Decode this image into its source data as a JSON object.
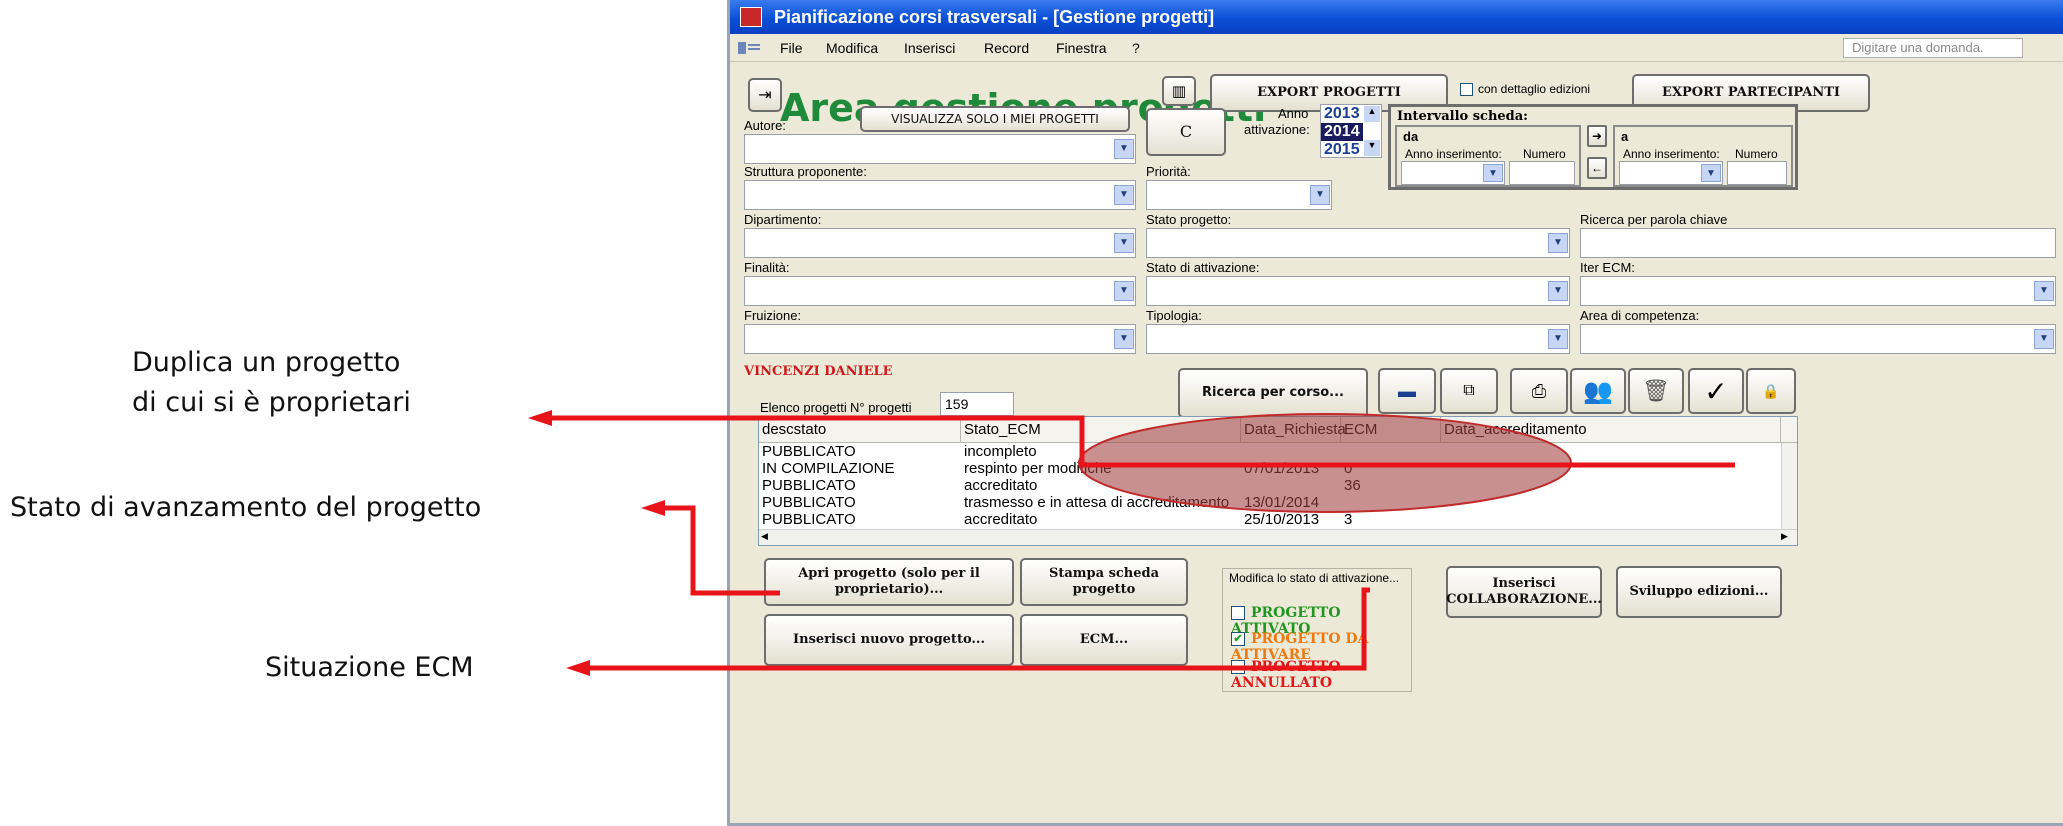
{
  "callouts": {
    "duplicate_line1": "Duplica un progetto",
    "duplicate_line2": "di cui si è proprietari",
    "status": "Stato di avanzamento del progetto",
    "ecm": "Situazione ECM"
  },
  "window": {
    "title": "Pianificazione corsi trasversali - [Gestione progetti]"
  },
  "menu": {
    "items": [
      "File",
      "Modifica",
      "Inserisci",
      "Record",
      "Finestra",
      "?"
    ],
    "help_placeholder": "Digitare una domanda."
  },
  "header": {
    "title": "Area gestione progetti",
    "export_projects": "EXPORT PROGETTI",
    "detail_checkbox": "con dettaglio edizioni",
    "export_participants": "EXPORT PARTECIPANTI"
  },
  "filters": {
    "author_label": "Autore:",
    "my_projects_button": "VISUALIZZA SOLO I MIEI PROGETTI",
    "refresh_icon": "C",
    "year_label_1": "Anno",
    "year_label_2": "attivazione:",
    "years": [
      "2013",
      "2014",
      "2015"
    ],
    "selected_year": "2014",
    "interval_title": "Intervallo scheda:",
    "from_label": "da",
    "to_label": "a",
    "insert_year_label": "Anno inserimento:",
    "number_label": "Numero",
    "structure_label": "Struttura proponente:",
    "priority_label": "Priorità:",
    "department_label": "Dipartimento:",
    "project_state_label": "Stato progetto:",
    "keyword_label": "Ricerca per parola chiave",
    "purpose_label": "Finalità:",
    "activation_state_label": "Stato di attivazione:",
    "ecm_iter_label": "Iter ECM:",
    "fruition_label": "Fruizione:",
    "type_label": "Tipologia:",
    "competence_label": "Area di competenza:"
  },
  "user": {
    "name": "VINCENZI DANIELE"
  },
  "list": {
    "title": "Elenco progetti",
    "count_label": "N° progetti",
    "count": "159",
    "search_button": "Ricerca per corso...",
    "columns": [
      "descstato",
      "Stato_ECM",
      "Data_Richiesta",
      "ECM",
      "Data_accreditamento"
    ],
    "rows": [
      [
        "PUBBLICATO",
        "incompleto",
        "",
        "",
        ""
      ],
      [
        "IN COMPILAZIONE",
        "respinto per modifiche",
        "07/01/2013",
        "0",
        ""
      ],
      [
        "PUBBLICATO",
        "accreditato",
        "",
        "36",
        ""
      ],
      [
        "PUBBLICATO",
        "trasmesso e in attesa di accreditamento",
        "13/01/2014",
        "",
        ""
      ],
      [
        "PUBBLICATO",
        "accreditato",
        "25/10/2013",
        "3",
        ""
      ]
    ]
  },
  "actions": {
    "open_project": "Apri progetto (solo per il proprietario)...",
    "print_card": "Stampa scheda progetto",
    "new_project": "Inserisci nuovo progetto...",
    "ecm": "ECM...",
    "modify_state_label": "Modifica lo stato di attivazione...",
    "state_active": "PROGETTO ATTIVATO",
    "state_to_activate": "PROGETTO DA ATTIVARE",
    "state_cancelled": "PROGETTO ANNULLATO",
    "insert_collab_1": "Inserisci",
    "insert_collab_2": "COLLABORAZIONE...",
    "editions": "Sviluppo edizioni..."
  },
  "colors": {
    "heading": "#1f8a3a",
    "arrow": "#e8141a",
    "highlight": "#a0403f",
    "user_name": "#d01818",
    "active": "#219621",
    "to_activate": "#f07a10",
    "cancelled": "#e01818"
  }
}
